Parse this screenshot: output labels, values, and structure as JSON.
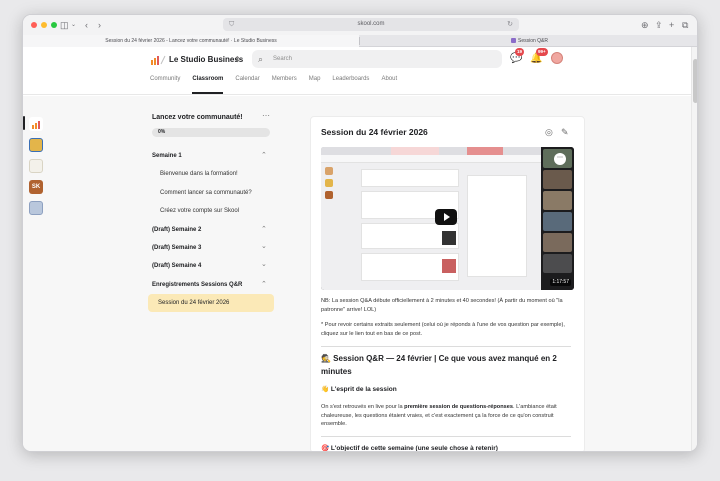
{
  "browser": {
    "url": "skool.com",
    "tabs": [
      {
        "title": "Session du 24 février 2026 - Lancez votre communauté! · Le Studio Business",
        "active": true
      },
      {
        "title": "Session Q&R",
        "active": false
      }
    ]
  },
  "header": {
    "brand": "Le Studio Business",
    "search_placeholder": "Search",
    "chat_badge": "19",
    "notif_badge": "99+",
    "nav": [
      "Community",
      "Classroom",
      "Calendar",
      "Members",
      "Map",
      "Leaderboards",
      "About"
    ],
    "active_nav": "Classroom"
  },
  "course": {
    "title": "Lancez votre communauté!",
    "progress_label": "0%",
    "progress": 0,
    "sections": [
      {
        "title": "Semaine 1",
        "expanded": true,
        "lessons": [
          "Bienvenue dans la formation!",
          "Comment lancer sa communauté?",
          "Créez votre compte sur Skool"
        ]
      },
      {
        "title": "(Draft) Semaine 2",
        "expanded": true,
        "lessons": []
      },
      {
        "title": "(Draft) Semaine 3",
        "expanded": false,
        "lessons": []
      },
      {
        "title": "(Draft) Semaine 4",
        "expanded": false,
        "lessons": []
      },
      {
        "title": "Enregistrements Sessions Q&R",
        "expanded": true,
        "lessons": [
          "Session du 24 février 2026"
        ]
      }
    ],
    "active_lesson": "Session du 24 février 2026"
  },
  "lesson": {
    "title": "Session du 24 février 2026",
    "video_duration": "1:17:57",
    "note": "NB: La session Q&A débute officiellement à 2 minutes et 40 secondes! (À partir du moment où \"la patronne\" arrive! LOL)",
    "extracts": "* Pour revoir certains extraits seulement (celui où je réponds à l'une de vos question par exemple), cliquez sur le lien tout en bas de ce post.",
    "heading": "🕵️ Session Q&R — 24 février | Ce que vous avez manqué en 2 minutes",
    "spirit_heading": "👋 L'esprit de la session",
    "spirit_text_1": "On s'est retrouvés en live pour la ",
    "spirit_text_bold": "première session de questions-réponses",
    "spirit_text_2": ". L'ambiance était chaleureuse, les questions étaient vraies, et c'est exactement ça la force de ce qu'on construit ensemble.",
    "goal_heading": "🎯 L'objectif de cette semaine (une seule chose à retenir)"
  },
  "colors": {
    "badge": "#e5484d",
    "active_lesson_bg": "#fbe9b7",
    "accent_logo": "#f28c28"
  }
}
